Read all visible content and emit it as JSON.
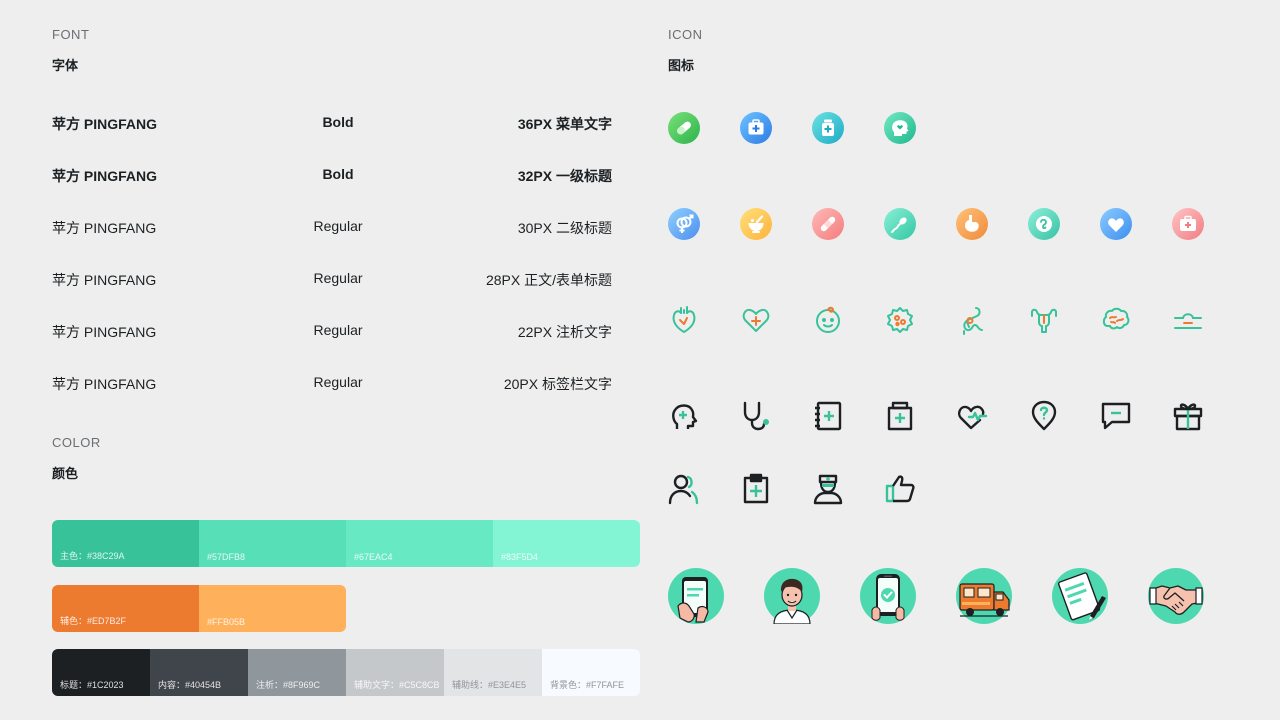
{
  "font_section": {
    "title_en": "FONT",
    "title_cn": "字体"
  },
  "font_rows": [
    {
      "name": "苹方 PINGFANG",
      "weight": "Bold",
      "size": "36PX 菜单文字"
    },
    {
      "name": "苹方 PINGFANG",
      "weight": "Bold",
      "size": "32PX 一级标题"
    },
    {
      "name": "苹方 PINGFANG",
      "weight": "Regular",
      "size": "30PX 二级标题"
    },
    {
      "name": "苹方 PINGFANG",
      "weight": "Regular",
      "size": "28PX 正文/表单标题"
    },
    {
      "name": "苹方 PINGFANG",
      "weight": "Regular",
      "size": "22PX 注析文字"
    },
    {
      "name": "苹方 PINGFANG",
      "weight": "Regular",
      "size": "20PX 标签栏文字"
    }
  ],
  "color_section": {
    "title_en": "COLOR",
    "title_cn": "颜色"
  },
  "primary_swatches": [
    {
      "label": "主色：#38C29A",
      "color": "#38C29A"
    },
    {
      "label": "#57DFB8",
      "color": "#57DFB8"
    },
    {
      "label": "#67EAC4",
      "color": "#67EAC4"
    },
    {
      "label": "#83F5D4",
      "color": "#83F5D4"
    }
  ],
  "secondary_swatches": [
    {
      "label": "辅色：#ED7B2F",
      "color": "#ED7B2F"
    },
    {
      "label": "#FFB05B",
      "color": "#FFB05B"
    }
  ],
  "neutral_swatches": [
    {
      "label": "标题：#1C2023",
      "color": "#1C2023"
    },
    {
      "label": "内容：#40454B",
      "color": "#40454B"
    },
    {
      "label": "注析：#8F969C",
      "color": "#8F969C"
    },
    {
      "label": "辅助文字：#C5C8CB",
      "color": "#C5C8CB"
    },
    {
      "label": "辅助线：#E3E4E5",
      "color": "#E3E4E5"
    },
    {
      "label": "背景色：#F7FAFE",
      "color": "#F7FAFE"
    }
  ],
  "icon_section": {
    "title_en": "ICON",
    "title_cn": "图标"
  },
  "icon_rows": [
    [
      "pill-icon",
      "first-aid-kit-icon",
      "medicine-bottle-icon",
      "mental-health-icon"
    ],
    [
      "gender-icon",
      "mortar-icon",
      "bandage-icon",
      "sperm-icon",
      "stomach-icon",
      "embryo-icon",
      "heart-icon",
      "medical-case-icon"
    ],
    [
      "heart-organ-icon",
      "heart-plus-icon",
      "child-face-icon",
      "virus-icon",
      "intestine-icon",
      "uterus-icon",
      "brain-icon",
      "skin-icon"
    ],
    [
      "head-cross-icon",
      "stethoscope-icon",
      "medical-record-icon",
      "medicine-jar-icon",
      "heartbeat-icon",
      "location-question-icon",
      "chat-minus-icon",
      "gift-icon"
    ],
    [
      "users-icon",
      "clipboard-cross-icon",
      "nurse-icon",
      "thumbs-up-icon"
    ]
  ],
  "illustrations": [
    "phone-hand-illustration",
    "doctor-illustration",
    "phone-check-illustration",
    "delivery-truck-illustration",
    "document-pen-illustration",
    "handshake-illustration"
  ]
}
